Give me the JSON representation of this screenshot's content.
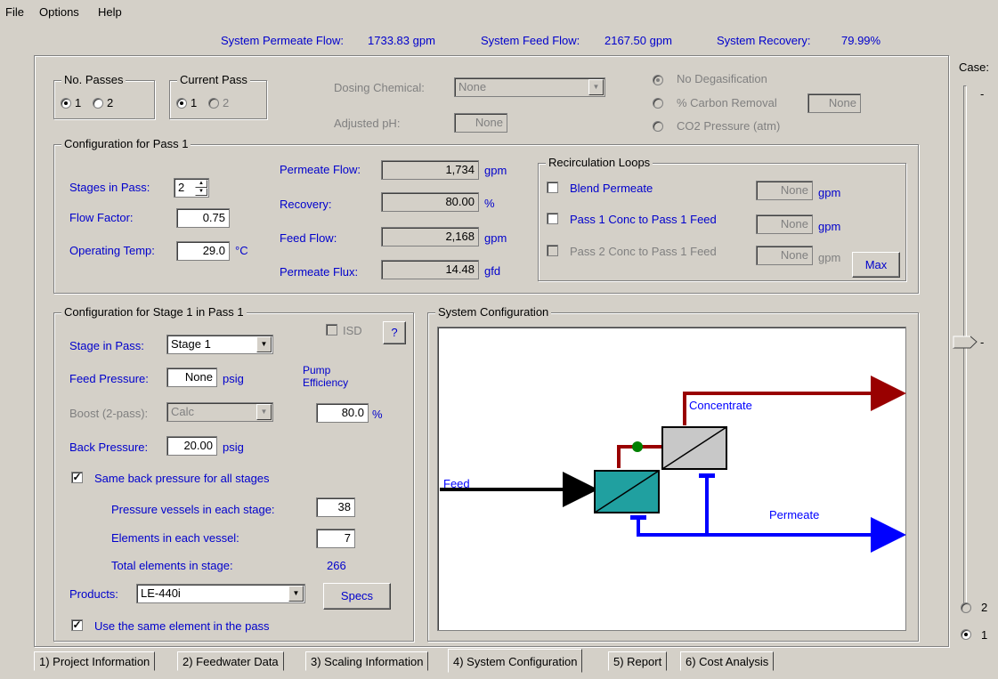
{
  "menu": [
    "File",
    "Options",
    "Help"
  ],
  "summary": {
    "permeate_label": "System Permeate Flow:",
    "permeate_value": "1733.83 gpm",
    "feed_label": "System Feed Flow:",
    "feed_value": "2167.50 gpm",
    "recovery_label": "System Recovery:",
    "recovery_value": "79.99%"
  },
  "no_passes": {
    "title": "No. Passes",
    "opt1": "1",
    "opt2": "2",
    "selected": "1"
  },
  "current_pass": {
    "title": "Current Pass",
    "opt1": "1",
    "opt2": "2",
    "selected": "1"
  },
  "dosing": {
    "chemical_label": "Dosing Chemical:",
    "chemical_value": "None",
    "ph_label": "Adjusted pH:",
    "ph_value": "None"
  },
  "degas": {
    "opt1": "No Degasification",
    "opt2": "% Carbon Removal",
    "opt2_value": "None",
    "opt3": "CO2 Pressure (atm)"
  },
  "case": {
    "label": "Case:",
    "tick": "-",
    "opt2": "2",
    "opt1": "1"
  },
  "pass_config": {
    "title": "Configuration for Pass 1",
    "stages_label": "Stages in Pass:",
    "stages_value": "2",
    "flow_factor_label": "Flow Factor:",
    "flow_factor_value": "0.75",
    "temp_label": "Operating Temp:",
    "temp_value": "29.0",
    "temp_unit": "°C",
    "permeate_flow_label": "Permeate Flow:",
    "permeate_flow_value": "1,734",
    "permeate_flow_unit": "gpm",
    "recovery_label": "Recovery:",
    "recovery_value": "80.00",
    "recovery_unit": "%",
    "feed_flow_label": "Feed Flow:",
    "feed_flow_value": "2,168",
    "feed_flow_unit": "gpm",
    "flux_label": "Permeate Flux:",
    "flux_value": "14.48",
    "flux_unit": "gfd"
  },
  "recirc": {
    "title": "Recirculation Loops",
    "blend_label": "Blend Permeate",
    "blend_value": "None",
    "blend_unit": "gpm",
    "p1_label": "Pass 1 Conc to Pass 1 Feed",
    "p1_value": "None",
    "p1_unit": "gpm",
    "p2_label": "Pass 2 Conc to Pass 1 Feed",
    "p2_value": "None",
    "p2_unit": "gpm",
    "max_label": "Max"
  },
  "stage_config": {
    "title": "Configuration for Stage 1 in Pass 1",
    "isd_label": "ISD",
    "help_label": "?",
    "stage_label": "Stage in Pass:",
    "stage_value": "Stage 1",
    "feed_pressure_label": "Feed Pressure:",
    "feed_pressure_value": "None",
    "feed_pressure_unit": "psig",
    "pump_label_1": "Pump",
    "pump_label_2": "Efficiency",
    "pump_value": "80.0",
    "pump_unit": "%",
    "boost_label": "Boost (2-pass):",
    "boost_value": "Calc",
    "back_pressure_label": "Back Pressure:",
    "back_pressure_value": "20.00",
    "back_pressure_unit": "psig",
    "same_bp_label": "Same back pressure for all stages",
    "vessels_label": "Pressure vessels in each stage:",
    "vessels_value": "38",
    "elements_label": "Elements in each vessel:",
    "elements_value": "7",
    "total_label": "Total elements in stage:",
    "total_value": "266",
    "products_label": "Products:",
    "products_value": "LE-440i",
    "specs_label": "Specs",
    "same_element_label": "Use the same element in the pass"
  },
  "system_config": {
    "title": "System Configuration",
    "feed": "Feed",
    "concentrate": "Concentrate",
    "permeate": "Permeate"
  },
  "tabs": [
    "1) Project Information",
    "2) Feedwater Data",
    "3) Scaling Information",
    "4) System Configuration",
    "5) Report",
    "6) Cost Analysis"
  ],
  "colors": {
    "label_blue": "#0000cc",
    "concentrate": "#990000",
    "permeate": "#0000ff",
    "stage1": "#20a0a0",
    "stage2": "#c8c8c8",
    "valve": "#008000"
  }
}
